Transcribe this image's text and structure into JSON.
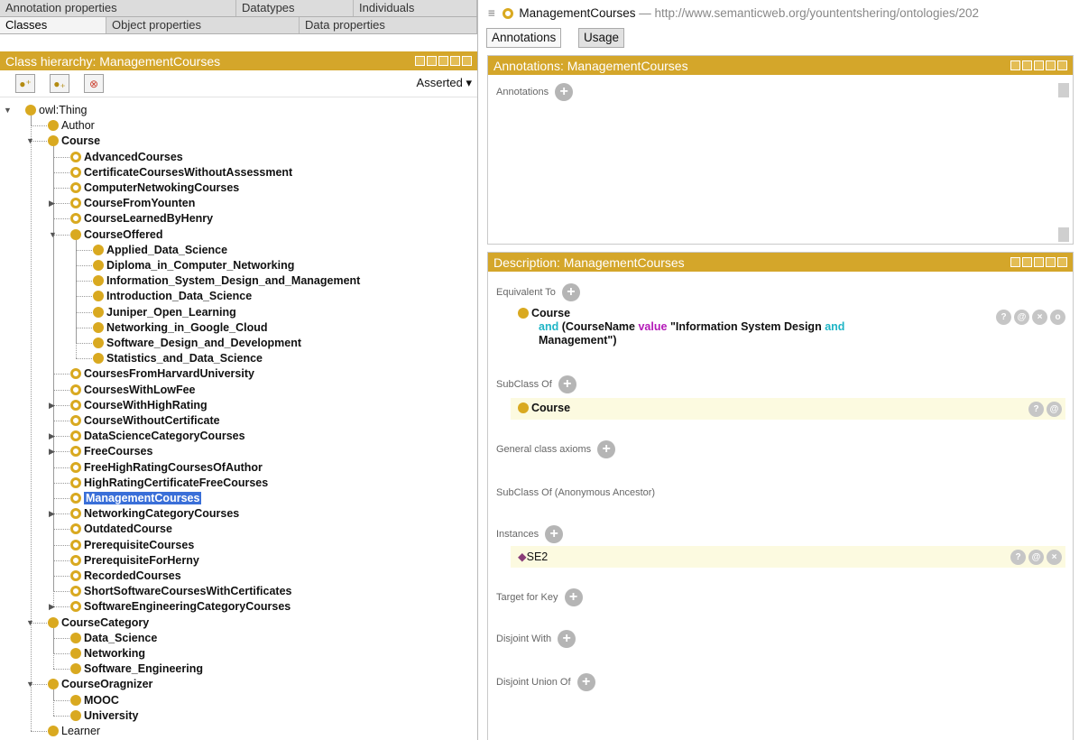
{
  "left": {
    "tabs_row1": [
      "Annotation properties",
      "Datatypes",
      "Individuals"
    ],
    "tabs_row2": [
      "Classes",
      "Object properties",
      "Data properties"
    ],
    "hierarchy_title": "Class hierarchy: ManagementCourses",
    "asserted_label": "Asserted ▾",
    "tree": [
      {
        "label": "owl:Thing",
        "level": 0,
        "expanded": true,
        "style": "filled",
        "plain": true
      },
      {
        "label": "Author",
        "level": 1,
        "style": "filled",
        "plain": true
      },
      {
        "label": "Course",
        "level": 1,
        "expanded": true,
        "style": "filled"
      },
      {
        "label": "AdvancedCourses",
        "level": 2,
        "style": "ring"
      },
      {
        "label": "CertificateCoursesWithoutAssessment",
        "level": 2,
        "style": "ring"
      },
      {
        "label": "ComputerNetwokingCourses",
        "level": 2,
        "style": "ring"
      },
      {
        "label": "CourseFromYounten",
        "level": 2,
        "collapsed": true,
        "style": "ring"
      },
      {
        "label": "CourseLearnedByHenry",
        "level": 2,
        "style": "ring"
      },
      {
        "label": "CourseOffered",
        "level": 2,
        "expanded": true,
        "style": "filled"
      },
      {
        "label": "Applied_Data_Science",
        "level": 3,
        "style": "filled"
      },
      {
        "label": "Diploma_in_Computer_Networking",
        "level": 3,
        "style": "filled"
      },
      {
        "label": "Information_System_Design_and_Management",
        "level": 3,
        "style": "filled"
      },
      {
        "label": "Introduction_Data_Science",
        "level": 3,
        "style": "filled"
      },
      {
        "label": "Juniper_Open_Learning",
        "level": 3,
        "style": "filled"
      },
      {
        "label": "Networking_in_Google_Cloud",
        "level": 3,
        "style": "filled"
      },
      {
        "label": "Software_Design_and_Development",
        "level": 3,
        "style": "filled"
      },
      {
        "label": "Statistics_and_Data_Science",
        "level": 3,
        "style": "filled"
      },
      {
        "label": "CoursesFromHarvardUniversity",
        "level": 2,
        "style": "ring"
      },
      {
        "label": "CoursesWithLowFee",
        "level": 2,
        "style": "ring"
      },
      {
        "label": "CourseWithHighRating",
        "level": 2,
        "collapsed": true,
        "style": "ring"
      },
      {
        "label": "CourseWithoutCertificate",
        "level": 2,
        "style": "ring"
      },
      {
        "label": "DataScienceCategoryCourses",
        "level": 2,
        "collapsed": true,
        "style": "ring"
      },
      {
        "label": "FreeCourses",
        "level": 2,
        "collapsed": true,
        "style": "ring"
      },
      {
        "label": "FreeHighRatingCoursesOfAuthor",
        "level": 2,
        "style": "ring"
      },
      {
        "label": "HighRatingCertificateFreeCourses",
        "level": 2,
        "style": "ring"
      },
      {
        "label": "ManagementCourses",
        "level": 2,
        "style": "ring",
        "selected": true
      },
      {
        "label": "NetworkingCategoryCourses",
        "level": 2,
        "collapsed": true,
        "style": "ring"
      },
      {
        "label": "OutdatedCourse",
        "level": 2,
        "style": "ring"
      },
      {
        "label": "PrerequisiteCourses",
        "level": 2,
        "style": "ring"
      },
      {
        "label": "PrerequisiteForHerny",
        "level": 2,
        "style": "ring"
      },
      {
        "label": "RecordedCourses",
        "level": 2,
        "style": "ring"
      },
      {
        "label": "ShortSoftwareCoursesWithCertificates",
        "level": 2,
        "style": "ring"
      },
      {
        "label": "SoftwareEngineeringCategoryCourses",
        "level": 2,
        "collapsed": true,
        "style": "ring"
      },
      {
        "label": "CourseCategory",
        "level": 1,
        "expanded": true,
        "style": "filled"
      },
      {
        "label": "Data_Science",
        "level": 2,
        "style": "filled"
      },
      {
        "label": "Networking",
        "level": 2,
        "style": "filled"
      },
      {
        "label": "Software_Engineering",
        "level": 2,
        "style": "filled"
      },
      {
        "label": "CourseOragnizer",
        "level": 1,
        "expanded": true,
        "style": "filled"
      },
      {
        "label": "MOOC",
        "level": 2,
        "style": "filled"
      },
      {
        "label": "University",
        "level": 2,
        "style": "filled"
      },
      {
        "label": "Learner",
        "level": 1,
        "style": "filled",
        "plain": true
      }
    ]
  },
  "right": {
    "entity_title": "ManagementCourses",
    "entity_url": "— http://www.semanticweb.org/yountentshering/ontologies/202",
    "tabs": [
      "Annotations",
      "Usage"
    ],
    "annotations_title": "Annotations: ManagementCourses",
    "annotations_label": "Annotations",
    "description_title": "Description: ManagementCourses",
    "equivalent_to_label": "Equivalent To",
    "equiv_class": "Course",
    "equiv_and": "and",
    "equiv_prefix": "(CourseName",
    "equiv_value": "value",
    "equiv_literal_1": "\"Information System Design",
    "equiv_and2": "and",
    "equiv_literal_2": "Management\")",
    "subclass_of_label": "SubClass Of",
    "subclass_value": "Course",
    "general_axioms_label": "General class axioms",
    "anon_ancestor_label": "SubClass Of (Anonymous Ancestor)",
    "instances_label": "Instances",
    "instance_value": "SE2",
    "target_key_label": "Target for Key",
    "disjoint_with_label": "Disjoint With",
    "disjoint_union_label": "Disjoint Union Of"
  }
}
